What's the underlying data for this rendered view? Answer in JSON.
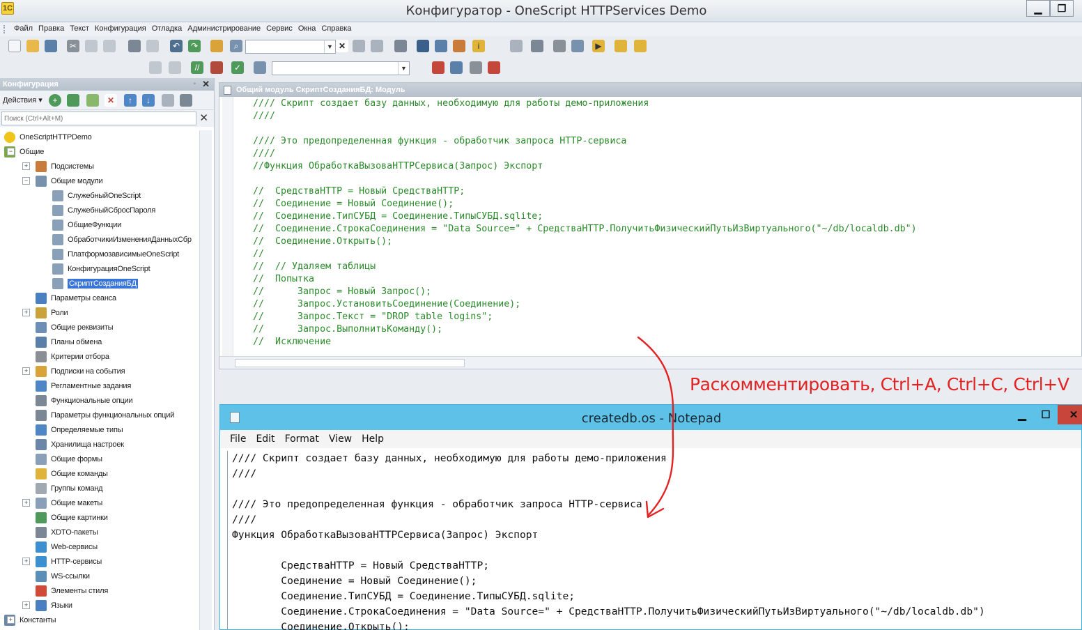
{
  "window": {
    "title": "Конфигуратор - OneScript HTTPServices Demo",
    "logo_text": "1С"
  },
  "menu": [
    "Файл",
    "Правка",
    "Текст",
    "Конфигурация",
    "Отладка",
    "Администрирование",
    "Сервис",
    "Окна",
    "Справка"
  ],
  "config_panel": {
    "title": "Конфигурация",
    "actions_label": "Действия ▾",
    "search_placeholder": "Поиск (Ctrl+Alt+M)",
    "tree": [
      {
        "label": "OneScriptHTTPDemo",
        "level": 0,
        "expander": "",
        "icon": "root-config-icon",
        "color": "#f0c419"
      },
      {
        "label": "Общие",
        "level": 0,
        "expander": "⊟",
        "icon": "common-icon",
        "color": "#7aa84b"
      },
      {
        "label": "Подсистемы",
        "level": 1,
        "expander": "⊞",
        "icon": "subsystems-icon",
        "color": "#c97b3a"
      },
      {
        "label": "Общие модули",
        "level": 1,
        "expander": "⊟",
        "icon": "common-modules-icon",
        "color": "#7891ad"
      },
      {
        "label": "СлужебныйOneScript",
        "level": 2,
        "expander": "",
        "icon": "module-icon",
        "color": "#8aa0b8"
      },
      {
        "label": "СлужебныйСбросПароля",
        "level": 2,
        "expander": "",
        "icon": "module-icon",
        "color": "#8aa0b8"
      },
      {
        "label": "ОбщиеФункции",
        "level": 2,
        "expander": "",
        "icon": "module-icon",
        "color": "#8aa0b8"
      },
      {
        "label": "ОбработчикиИзмененияДанныхСбр",
        "level": 2,
        "expander": "",
        "icon": "module-icon",
        "color": "#8aa0b8"
      },
      {
        "label": "ПлатформозависимыеOneScript",
        "level": 2,
        "expander": "",
        "icon": "module-icon",
        "color": "#8aa0b8"
      },
      {
        "label": "КонфигурацияOneScript",
        "level": 2,
        "expander": "",
        "icon": "module-icon",
        "color": "#8aa0b8"
      },
      {
        "label": "СкриптСозданияБД",
        "level": 2,
        "expander": "",
        "icon": "module-icon",
        "color": "#8aa0b8",
        "selected": true
      },
      {
        "label": "Параметры сеанса",
        "level": 1,
        "expander": "",
        "icon": "session-params-icon",
        "color": "#4a7fc1"
      },
      {
        "label": "Роли",
        "level": 1,
        "expander": "⊞",
        "icon": "roles-icon",
        "color": "#c9a23a"
      },
      {
        "label": "Общие реквизиты",
        "level": 1,
        "expander": "",
        "icon": "common-attributes-icon",
        "color": "#6d8fb5"
      },
      {
        "label": "Планы обмена",
        "level": 1,
        "expander": "",
        "icon": "exchange-plans-icon",
        "color": "#5a7fa8"
      },
      {
        "label": "Критерии отбора",
        "level": 1,
        "expander": "",
        "icon": "filter-criteria-icon",
        "color": "#8a8f96"
      },
      {
        "label": "Подписки на события",
        "level": 1,
        "expander": "⊞",
        "icon": "event-subscriptions-icon",
        "color": "#d9a33a"
      },
      {
        "label": "Регламентные задания",
        "level": 1,
        "expander": "",
        "icon": "scheduled-jobs-icon",
        "color": "#4f86c6"
      },
      {
        "label": "Функциональные опции",
        "level": 1,
        "expander": "",
        "icon": "functional-options-icon",
        "color": "#7b8794"
      },
      {
        "label": "Параметры функциональных опций",
        "level": 1,
        "expander": "",
        "icon": "functional-option-params-icon",
        "color": "#7b8794"
      },
      {
        "label": "Определяемые типы",
        "level": 1,
        "expander": "",
        "icon": "defined-types-icon",
        "color": "#4f86c6"
      },
      {
        "label": "Хранилища настроек",
        "level": 1,
        "expander": "",
        "icon": "settings-storages-icon",
        "color": "#6a87a8"
      },
      {
        "label": "Общие формы",
        "level": 1,
        "expander": "",
        "icon": "common-forms-icon",
        "color": "#8aa0b8"
      },
      {
        "label": "Общие команды",
        "level": 1,
        "expander": "",
        "icon": "common-commands-icon",
        "color": "#e0b33a"
      },
      {
        "label": "Группы команд",
        "level": 1,
        "expander": "",
        "icon": "command-groups-icon",
        "color": "#a0a8b0"
      },
      {
        "label": "Общие макеты",
        "level": 1,
        "expander": "⊞",
        "icon": "common-templates-icon",
        "color": "#8aa0b8"
      },
      {
        "label": "Общие картинки",
        "level": 1,
        "expander": "",
        "icon": "common-pictures-icon",
        "color": "#4f9a5a"
      },
      {
        "label": "XDTO-пакеты",
        "level": 1,
        "expander": "",
        "icon": "xdto-packages-icon",
        "color": "#7b8794"
      },
      {
        "label": "Web-сервисы",
        "level": 1,
        "expander": "",
        "icon": "web-services-icon",
        "color": "#3c8fd0"
      },
      {
        "label": "HTTP-сервисы",
        "level": 1,
        "expander": "⊞",
        "icon": "http-services-icon",
        "color": "#3c8fd0"
      },
      {
        "label": "WS-ссылки",
        "level": 1,
        "expander": "",
        "icon": "ws-references-icon",
        "color": "#5a8fb8"
      },
      {
        "label": "Элементы стиля",
        "level": 1,
        "expander": "",
        "icon": "style-items-icon",
        "color": "#d04a3a"
      },
      {
        "label": "Языки",
        "level": 1,
        "expander": "⊞",
        "icon": "languages-icon",
        "color": "#4a7fc1"
      },
      {
        "label": "Константы",
        "level": 0,
        "expander": "⊞",
        "icon": "constants-icon",
        "color": "#6a87a8"
      }
    ]
  },
  "editor": {
    "title": "Общий модуль СкриптСозданияБД: Модуль",
    "lines": [
      "//// Скрипт создает базу данных, необходимую для работы демо-приложения",
      "////",
      "",
      "//// Это предопределенная функция - обработчик запроса HTTP-сервиса",
      "////",
      "//Функция ОбработкаВызоваHTTPСервиса(Запрос) Экспорт",
      "",
      "//  СредстваHTTP = Новый СредстваHTTP;",
      "//  Соединение = Новый Соединение();",
      "//  Соединение.ТипСУБД = Соединение.ТипыСУБД.sqlite;",
      "//  Соединение.СтрокаСоединения = \"Data Source=\" + СредстваHTTP.ПолучитьФизическийПутьИзВиртуального(\"~/db/localdb.db\")",
      "//  Соединение.Открыть();",
      "//",
      "//  // Удаляем таблицы",
      "//  Попытка",
      "//      Запрос = Новый Запрос();",
      "//      Запрос.УстановитьСоединение(Соединение);",
      "//      Запрос.Текст = \"DROP table logins\";",
      "//      Запрос.ВыполнитьКоманду();",
      "//  Исключение"
    ]
  },
  "annotation": {
    "text": "Раскомментировать, Ctrl+A, Ctrl+C, Ctrl+V",
    "color": "#e32121"
  },
  "notepad": {
    "title": "createdb.os - Notepad",
    "menu": [
      "File",
      "Edit",
      "Format",
      "View",
      "Help"
    ],
    "lines": [
      "//// Скрипт создает базу данных, необходимую для работы демо-приложения",
      "////",
      "",
      "//// Это предопределенная функция - обработчик запроса HTTP-сервиса",
      "////",
      "Функция ОбработкаВызоваHTTPСервиса(Запрос) Экспорт",
      "",
      "        СредстваHTTP = Новый СредстваHTTP;",
      "        Соединение = Новый Соединение();",
      "        Соединение.ТипСУБД = Соединение.ТипыСУБД.sqlite;",
      "        Соединение.СтрокаСоединения = \"Data Source=\" + СредстваHTTP.ПолучитьФизическийПутьИзВиртуального(\"~/db/localdb.db\")",
      "        Соединение.Открыть();"
    ]
  }
}
